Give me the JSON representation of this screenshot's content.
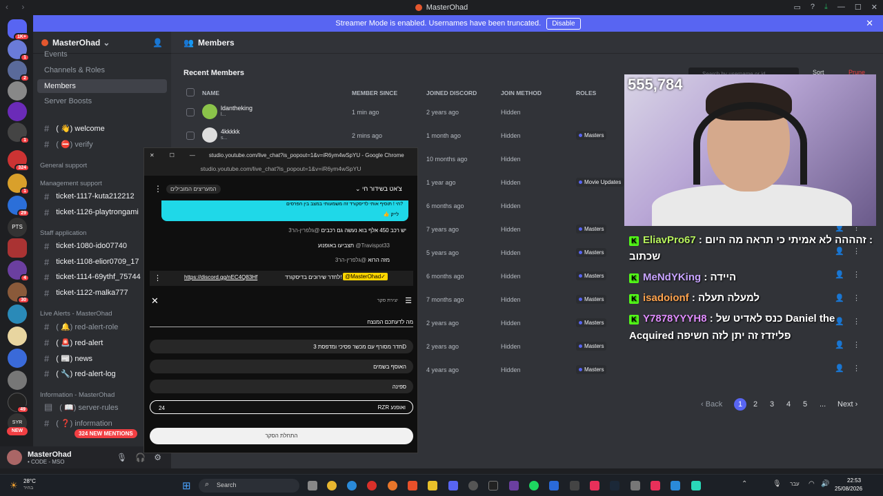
{
  "window": {
    "title": "MasterOhad"
  },
  "banner": {
    "text": "Streamer Mode is enabled. Usernames have been truncated.",
    "button": "Disable"
  },
  "rail": {
    "badges": [
      "1K+",
      "1",
      "2",
      "1",
      "324",
      "1",
      "29",
      "PTS",
      "4",
      "30",
      "49",
      "SYR",
      "NEW"
    ]
  },
  "server": {
    "name": "MasterOhad"
  },
  "sidebar": {
    "items": [
      {
        "label": "Events"
      },
      {
        "label": "Channels & Roles"
      },
      {
        "label": "Members"
      },
      {
        "label": "Server Boosts"
      }
    ],
    "channels": [
      {
        "label": "( 👋) welcome"
      },
      {
        "label": "( ⛔) verify"
      },
      {
        "label": "ticket-1117-kuta212212"
      },
      {
        "label": "ticket-1126-playtrongami"
      },
      {
        "label": "ticket-1080-ido07740"
      },
      {
        "label": "ticket-1108-elior0709_17"
      },
      {
        "label": "ticket-1114-69ythf_75744"
      },
      {
        "label": "ticket-1122-malka777"
      },
      {
        "label": "( 🔔) red-alert-role"
      },
      {
        "label": "( 🚨) red-alert"
      },
      {
        "label": "( 📰) news"
      },
      {
        "label": "( 🔧) red-alert-log"
      },
      {
        "label": "( 📖) server-rules"
      },
      {
        "label": "( ❓) information"
      }
    ],
    "categories": [
      "General support",
      "Management support",
      "Staff application",
      "Live Alerts - MasterOhad",
      "Information - MasterOhad"
    ],
    "mentions": "324 NEW MENTIONS"
  },
  "user": {
    "name": "MasterOhad",
    "status": "• CODE - MSO"
  },
  "main": {
    "title": "Members",
    "section": "Recent Members",
    "search_placeholder": "Search by username or id",
    "sort": "Sort",
    "prune": "Prune",
    "columns": [
      "NAME",
      "MEMBER SINCE",
      "JOINED DISCORD",
      "JOIN METHOD",
      "ROLES"
    ],
    "rows": [
      {
        "name": "ldantheking",
        "sub": "l...",
        "since": "1 min ago",
        "joined": "2 years ago",
        "method": "Hidden",
        "role": ""
      },
      {
        "name": "4kkkkk",
        "sub": "s...",
        "since": "2 mins ago",
        "joined": "1 month ago",
        "method": "Hidden",
        "role": "Masters"
      },
      {
        "name": "",
        "sub": "",
        "since": "",
        "joined": "10 months ago",
        "method": "Hidden",
        "role": ""
      },
      {
        "name": "",
        "sub": "",
        "since": "",
        "joined": "1 year ago",
        "method": "Hidden",
        "role": "Movie Updates"
      },
      {
        "name": "",
        "sub": "",
        "since": "",
        "joined": "6 months ago",
        "method": "Hidden",
        "role": ""
      },
      {
        "name": "",
        "sub": "",
        "since": "",
        "joined": "7 years ago",
        "method": "Hidden",
        "role": "Masters"
      },
      {
        "name": "",
        "sub": "",
        "since": "",
        "joined": "5 years ago",
        "method": "Hidden",
        "role": "Masters"
      },
      {
        "name": "",
        "sub": "",
        "since": "",
        "joined": "6 months ago",
        "method": "Hidden",
        "role": "Masters"
      },
      {
        "name": "",
        "sub": "",
        "since": "",
        "joined": "7 months ago",
        "method": "Hidden",
        "role": "Masters"
      },
      {
        "name": "",
        "sub": "",
        "since": "",
        "joined": "2 years ago",
        "method": "Hidden",
        "role": "Masters"
      },
      {
        "name": "",
        "sub": "",
        "since": "",
        "joined": "2 years ago",
        "method": "Hidden",
        "role": "Masters"
      },
      {
        "name": "",
        "sub": "",
        "since": "",
        "joined": "4 years ago",
        "method": "Hidden",
        "role": "Masters"
      }
    ],
    "pagination": {
      "back": "Back",
      "pages": [
        "1",
        "2",
        "3",
        "4",
        "5",
        "..."
      ],
      "next": "Next"
    }
  },
  "overlay": {
    "counter": "555,784",
    "chat": [
      {
        "user": "EliavPro67",
        "text": ": זהההה לא אמיתי כי תראה מה היום :",
        "cont": "שכתוב"
      },
      {
        "user": "MeNdYKing",
        "text": ": היידה"
      },
      {
        "user": "isadoionf",
        "text": ": למעלה תעלה"
      },
      {
        "user": "Y7878YYYH8",
        "text": ": כנס לאדיט של Daniel the",
        "cont": "Acquired פליזדז זה יתן לזה חשיפה"
      }
    ]
  },
  "popout": {
    "title": "studio.youtube.com/live_chat?is_popout=1&v=iR6ym4wSpYU - Google Chrome",
    "url": "studio.youtube.com/live_chat?is_popout=1&v=iR6ym4wSpYU",
    "header": "צ'אט בשידור חי",
    "top_fans": "המעריצים המובילים",
    "pinned": "הי ! תוסיף אותי לדיסקורד זה משמעותי במצב בין הפרסים?",
    "like": "לייק",
    "messages": [
      {
        "user": "@גלפרין-הר3",
        "text": "יש רכב 450 אלף בוא נעשה גם רכבים"
      },
      {
        "user": "@Travispot33",
        "text": "תצביעו באופנוע"
      },
      {
        "user": "@גלפרין-הר3",
        "text": "מזה הרוא"
      }
    ],
    "my_msg": {
      "user": "@MasterOhad✓",
      "text": "לחדר שירוכים בדיסקורד!",
      "link": "https://discord.gg/nEC4Q83Hf"
    },
    "poll": {
      "label": "יצירת סקר",
      "question": "מה לדעתכם המנצח",
      "options": [
        "חדר מסורף עם מכשר פסיכי ומדפסת 3D",
        "האוסף בשמים",
        "ספינה",
        "RZR ואופנע"
      ],
      "count": "24",
      "start": "התחלת הסקר"
    }
  },
  "taskbar": {
    "weather": "28°C",
    "weather_sub": "בהיר",
    "search": "Search",
    "lang": "עבר",
    "time": "22:53",
    "date": "25/08/2026"
  }
}
